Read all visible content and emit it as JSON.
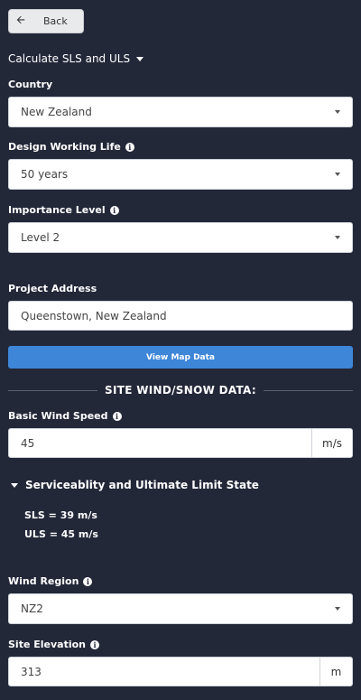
{
  "back": {
    "label": "Back",
    "icon": "arrow-left-icon"
  },
  "calc_dropdown": {
    "label": "Calculate SLS and ULS"
  },
  "country": {
    "label": "Country",
    "value": "New Zealand"
  },
  "design_life": {
    "label": "Design Working Life",
    "value": "50 years"
  },
  "importance": {
    "label": "Importance Level",
    "value": "Level 2"
  },
  "project_address": {
    "label": "Project Address",
    "value": "Queenstown, New Zealand"
  },
  "map_button": {
    "label": "View Map Data"
  },
  "section": {
    "title": "SITE WIND/SNOW DATA:"
  },
  "wind_speed": {
    "label": "Basic Wind Speed",
    "value": "45",
    "unit": "m/s"
  },
  "limit_state": {
    "title": "Serviceablity and Ultimate Limit State",
    "sls": "SLS = 39 m/s",
    "uls": "ULS = 45 m/s"
  },
  "wind_region": {
    "label": "Wind Region",
    "value": "NZ2"
  },
  "site_elevation": {
    "label": "Site Elevation",
    "value": "313",
    "unit": "m"
  },
  "colors": {
    "background": "#232839",
    "accent": "#3d86d8"
  }
}
